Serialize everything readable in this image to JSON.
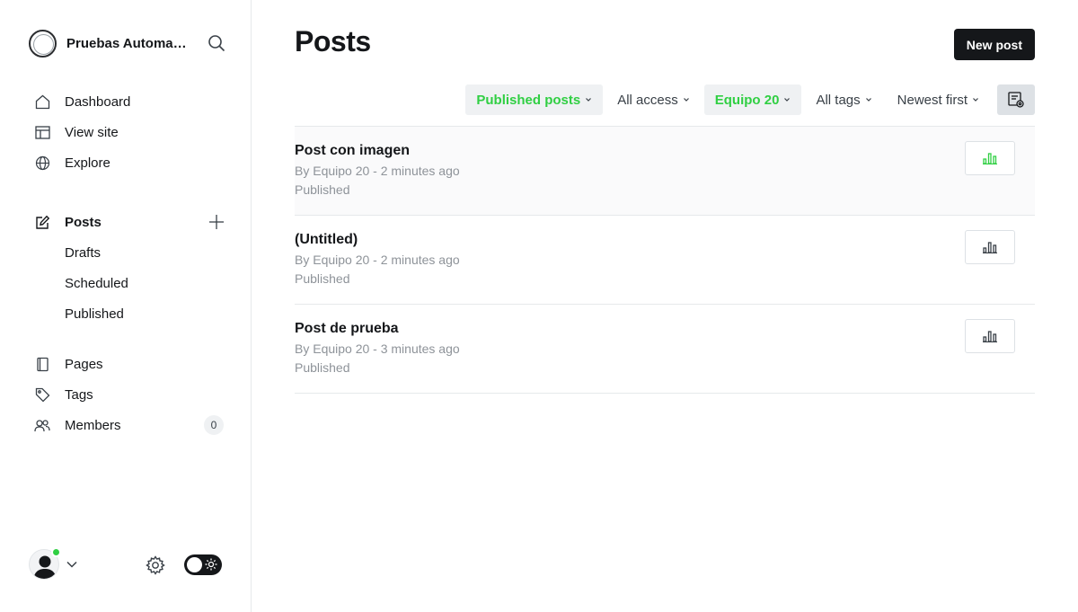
{
  "brand": {
    "name": "Pruebas Automatizadas"
  },
  "nav": {
    "dashboard": "Dashboard",
    "view_site": "View site",
    "explore": "Explore",
    "posts": "Posts",
    "drafts": "Drafts",
    "scheduled": "Scheduled",
    "published": "Published",
    "pages": "Pages",
    "tags": "Tags",
    "members": "Members",
    "members_count": "0"
  },
  "header": {
    "title": "Posts",
    "new_post": "New post"
  },
  "filters": {
    "type": "Published posts",
    "access": "All access",
    "author": "Equipo 20",
    "tags": "All tags",
    "order": "Newest first"
  },
  "posts": [
    {
      "title": "Post con imagen",
      "meta": "By Equipo 20 - 2 minutes ago",
      "status": "Published"
    },
    {
      "title": "(Untitled)",
      "meta": "By Equipo 20 - 2 minutes ago",
      "status": "Published"
    },
    {
      "title": "Post de prueba",
      "meta": "By Equipo 20 - 3 minutes ago",
      "status": "Published"
    }
  ],
  "colors": {
    "accent": "#30cf43",
    "text": "#15171a",
    "muted": "#8e9399",
    "border": "#e6e9eb"
  }
}
